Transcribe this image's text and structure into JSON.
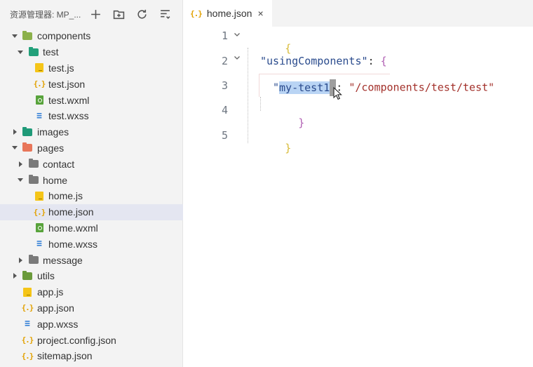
{
  "explorer": {
    "title": "资源管理器: MP_...",
    "actions": [
      "new-file",
      "new-folder",
      "refresh",
      "collapse-all"
    ],
    "items": [
      {
        "label": "components",
        "kind": "folder",
        "color": "#8bb04a",
        "depth": 0,
        "state": "open"
      },
      {
        "label": "test",
        "kind": "folder",
        "color": "#22a07a",
        "depth": 1,
        "state": "open"
      },
      {
        "label": "test.js",
        "kind": "js",
        "depth": 2
      },
      {
        "label": "test.json",
        "kind": "json",
        "depth": 2
      },
      {
        "label": "test.wxml",
        "kind": "wxml",
        "depth": 2
      },
      {
        "label": "test.wxss",
        "kind": "wxss",
        "depth": 2
      },
      {
        "label": "images",
        "kind": "folder",
        "color": "#1f9a78",
        "depth": 0,
        "state": "closed"
      },
      {
        "label": "pages",
        "kind": "folder",
        "color": "#e8765a",
        "depth": 0,
        "state": "open"
      },
      {
        "label": "contact",
        "kind": "folder",
        "color": "#7a7a7a",
        "depth": 1,
        "state": "closed"
      },
      {
        "label": "home",
        "kind": "folder",
        "color": "#7a7a7a",
        "depth": 1,
        "state": "open"
      },
      {
        "label": "home.js",
        "kind": "js",
        "depth": 2
      },
      {
        "label": "home.json",
        "kind": "json",
        "depth": 2,
        "selected": true
      },
      {
        "label": "home.wxml",
        "kind": "wxml",
        "depth": 2
      },
      {
        "label": "home.wxss",
        "kind": "wxss",
        "depth": 2
      },
      {
        "label": "message",
        "kind": "folder",
        "color": "#7a7a7a",
        "depth": 1,
        "state": "closed"
      },
      {
        "label": "utils",
        "kind": "folder",
        "color": "#6a9a3a",
        "depth": 0,
        "state": "closed"
      },
      {
        "label": "app.js",
        "kind": "js",
        "depth": 0
      },
      {
        "label": "app.json",
        "kind": "json",
        "depth": 0
      },
      {
        "label": "app.wxss",
        "kind": "wxss",
        "depth": 0
      },
      {
        "label": "project.config.json",
        "kind": "json",
        "depth": 0
      },
      {
        "label": "sitemap.json",
        "kind": "json",
        "depth": 0
      }
    ]
  },
  "editor": {
    "tab": {
      "icon": "{.}",
      "label": "home.json",
      "close": "×"
    },
    "lines": [
      {
        "number": "1"
      },
      {
        "number": "2"
      },
      {
        "number": "3"
      },
      {
        "number": "4"
      },
      {
        "number": "5"
      }
    ],
    "code": {
      "open_brace": "{",
      "key_using": "\"usingComponents\"",
      "colon_space": ": ",
      "inner_open": "{",
      "quote": "\"",
      "key_selected": "my-test1",
      "after_key": ": ",
      "path_value": "\"/components/test/test\"",
      "inner_close": "}",
      "close_brace": "}"
    }
  },
  "colors": {
    "sidebar_bg": "#f3f3f3",
    "selection_bg": "#e4e6f1",
    "text_selection": "#b9d4f4",
    "json_key": "#2a4b8d",
    "json_string": "#a3312b",
    "brace_outer": "#d7ba36",
    "brace_inner": "#b05fb3"
  }
}
